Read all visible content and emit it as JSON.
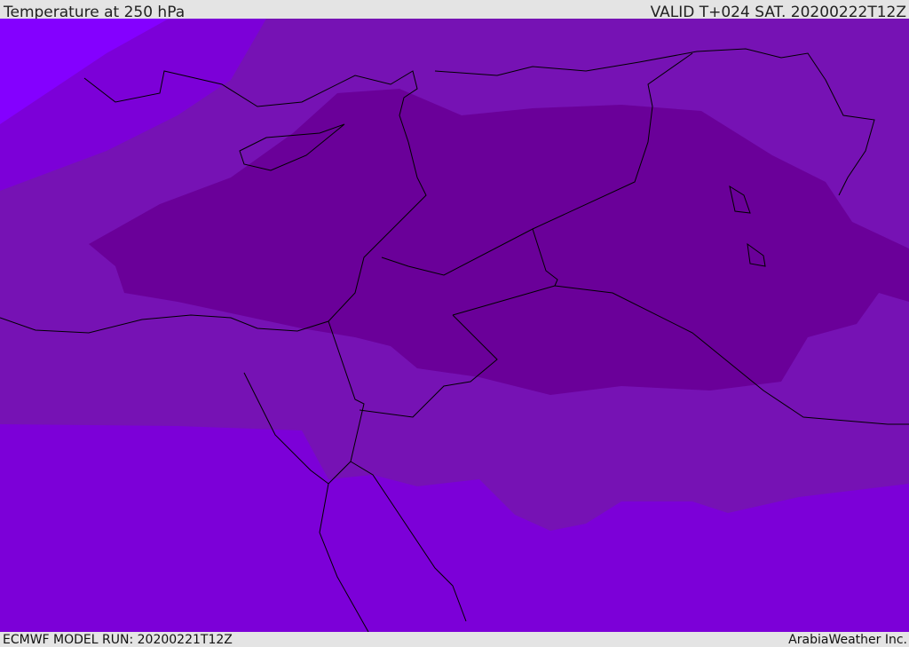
{
  "header": {
    "title": "Temperature at 250 hPa",
    "valid": "VALID T+024 SAT. 20200222T12Z"
  },
  "footer": {
    "model_run": "ECMWF MODEL RUN: 20200221T12Z",
    "brand": "ArabiaWeather Inc."
  },
  "colors": {
    "coldest_band": "#6a0099",
    "cool_band": "#7612b4",
    "mid_band": "#7c00d8",
    "warm_band": "#8000f0",
    "warmest_band": "#8400ff",
    "borders": "#000000",
    "header_bg": "#e4e4e4"
  }
}
